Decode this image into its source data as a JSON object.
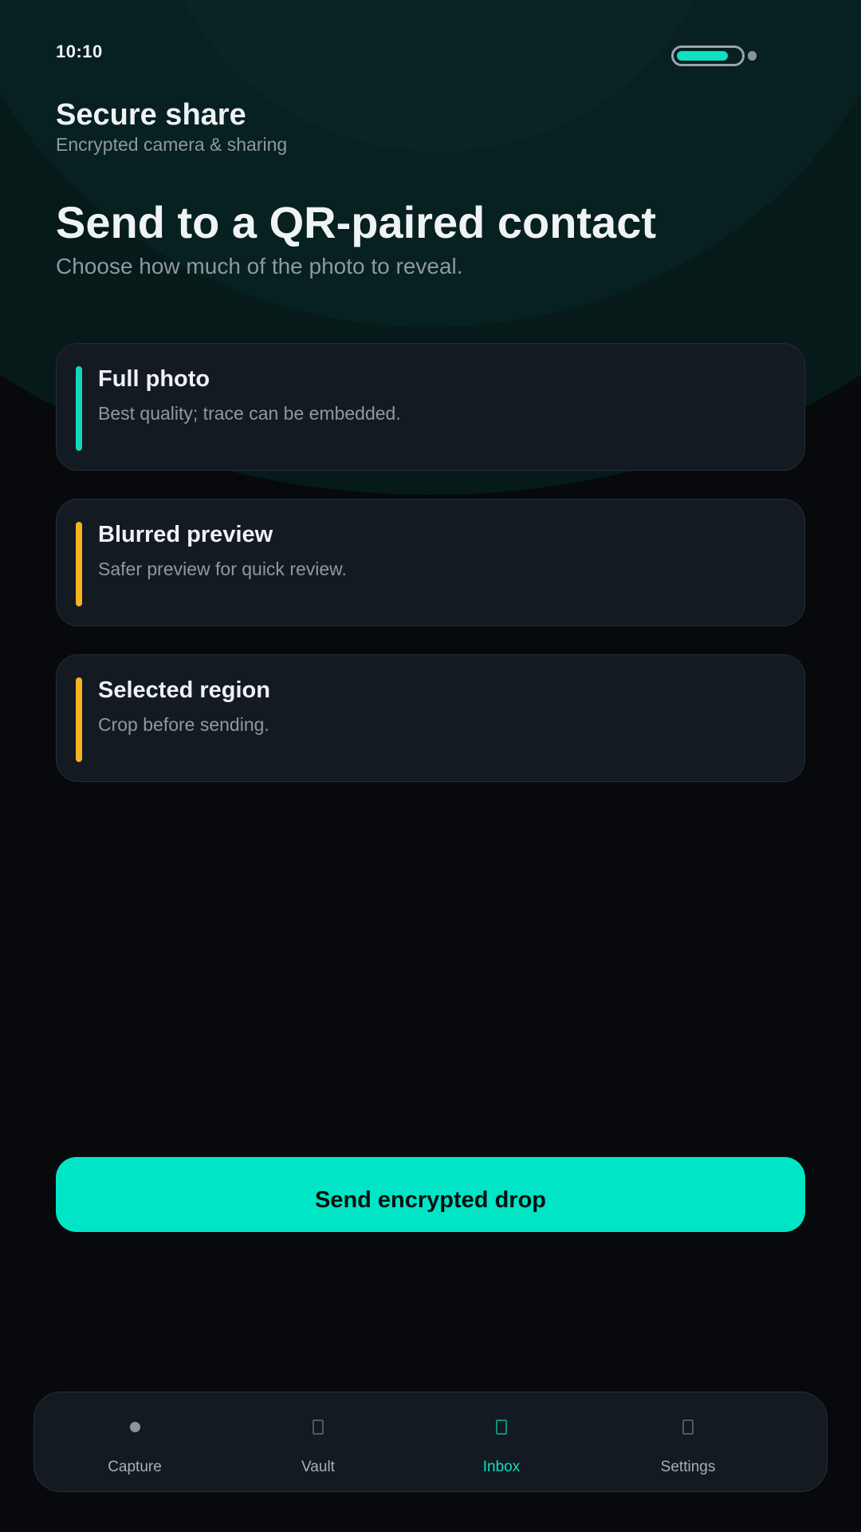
{
  "status_bar": {
    "time": "10:10",
    "battery_level": 0.8
  },
  "header": {
    "title": "Secure share",
    "subtitle": "Encrypted camera & sharing"
  },
  "hero": {
    "title": "Send to a QR-paired contact",
    "subtitle": "Choose how much of the photo to reveal."
  },
  "options": [
    {
      "title": "Full photo",
      "description": "Best quality; trace can be embedded.",
      "accent_color": "#12d6bd"
    },
    {
      "title": "Blurred preview",
      "description": "Safer preview for quick review.",
      "accent_color": "#f7b21f"
    },
    {
      "title": "Selected region",
      "description": "Crop before sending.",
      "accent_color": "#f7b21f"
    }
  ],
  "send_button": {
    "label": "Send encrypted drop"
  },
  "bottom_nav": {
    "items": [
      {
        "label": "Capture",
        "icon": "camera-dot-icon",
        "active": false
      },
      {
        "label": "Vault",
        "icon": "vault-icon",
        "active": false
      },
      {
        "label": "Inbox",
        "icon": "inbox-icon",
        "active": true
      },
      {
        "label": "Settings",
        "icon": "settings-icon",
        "active": false
      }
    ]
  },
  "colors": {
    "background": "#07090c",
    "card": "#141a21",
    "accent": "#00e5c6",
    "warning": "#f7b21f",
    "text_primary": "#eef1f5",
    "text_secondary": "#8e98a3"
  }
}
